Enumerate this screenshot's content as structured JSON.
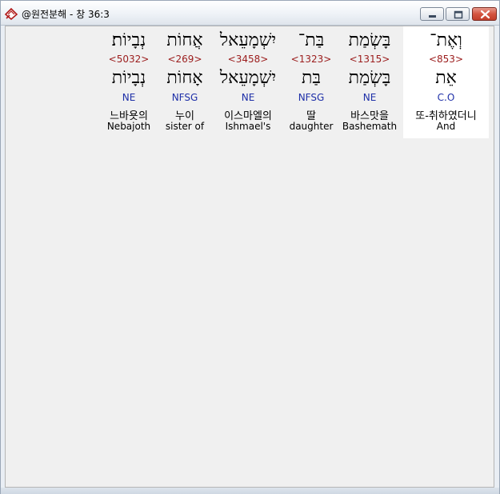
{
  "window": {
    "title": "@원전분해 - 창 36:3"
  },
  "words": [
    {
      "hebrew": "וְאֶת־",
      "strong": "<853>",
      "root": "אֵת",
      "pos": "C.O",
      "korean": "또-취하였더니",
      "english": "And"
    },
    {
      "hebrew": "בָּשְׂמַת",
      "strong": "<1315>",
      "root": "בָּשְׂמַת",
      "pos": "NE",
      "korean": "바스맛을",
      "english": "Bashemath"
    },
    {
      "hebrew": "בַּת־",
      "strong": "<1323>",
      "root": "בַּת",
      "pos": "NFSG",
      "korean": "딸",
      "english": "daughter"
    },
    {
      "hebrew": "יִשְׁמָעֵאל",
      "strong": "<3458>",
      "root": "יִשְׁמָעֵאל",
      "pos": "NE",
      "korean": "이스마엘의",
      "english": "Ishmael's"
    },
    {
      "hebrew": "אֲחוֹת",
      "strong": "<269>",
      "root": "אָחוֹת",
      "pos": "NFSG",
      "korean": "누이",
      "english": "sister of"
    },
    {
      "hebrew": "נְבָיוֹת׃",
      "strong": "<5032>",
      "root": "נְבָיוֹת",
      "pos": "NE",
      "korean": "느바욧의",
      "english": "Nebajoth"
    }
  ]
}
